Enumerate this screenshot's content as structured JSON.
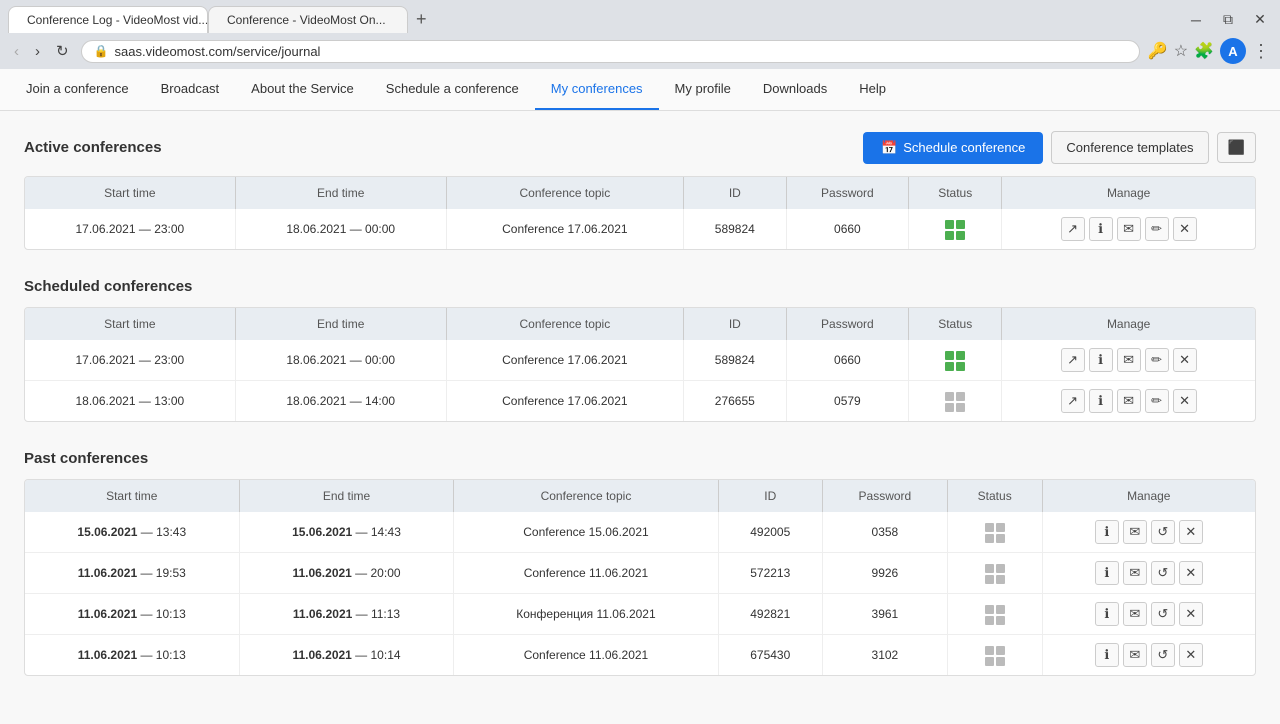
{
  "browser": {
    "tabs": [
      {
        "id": "tab1",
        "label": "Conference Log - VideoMost vid...",
        "favicon_type": "multi",
        "active": true,
        "url": "saas.videomost.com/service/journal"
      },
      {
        "id": "tab2",
        "label": "Conference - VideoMost On...",
        "favicon_type": "red",
        "active": false,
        "url": ""
      }
    ],
    "url": "saas.videomost.com/service/journal",
    "nav_buttons": {
      "back": "‹",
      "forward": "›",
      "reload": "↻"
    }
  },
  "nav": {
    "items": [
      {
        "label": "Join a conference",
        "active": false
      },
      {
        "label": "Broadcast",
        "active": false
      },
      {
        "label": "About the Service",
        "active": false
      },
      {
        "label": "Schedule a conference",
        "active": false
      },
      {
        "label": "My conferences",
        "active": true
      },
      {
        "label": "My profile",
        "active": false
      },
      {
        "label": "Downloads",
        "active": false
      },
      {
        "label": "Help",
        "active": false
      }
    ]
  },
  "page": {
    "active_conferences": {
      "title": "Active conferences",
      "schedule_btn": "Schedule conference",
      "templates_btn": "Conference templates",
      "table": {
        "columns": [
          "Start time",
          "End time",
          "Conference topic",
          "ID",
          "Password",
          "Status",
          "Manage"
        ],
        "rows": [
          {
            "start": "17.06.2021 — 23:00",
            "end": "18.06.2021 — 00:00",
            "topic": "Conference 17.06.2021",
            "id": "589824",
            "password": "0660",
            "status": "active"
          }
        ]
      }
    },
    "scheduled_conferences": {
      "title": "Scheduled conferences",
      "table": {
        "columns": [
          "Start time",
          "End time",
          "Conference topic",
          "ID",
          "Password",
          "Status",
          "Manage"
        ],
        "rows": [
          {
            "start": "17.06.2021 — 23:00",
            "end": "18.06.2021 — 00:00",
            "topic": "Conference 17.06.2021",
            "id": "589824",
            "password": "0660",
            "status": "active"
          },
          {
            "start": "18.06.2021 — 13:00",
            "end": "18.06.2021 — 14:00",
            "topic": "Conference 17.06.2021",
            "id": "276655",
            "password": "0579",
            "status": "inactive"
          }
        ]
      }
    },
    "past_conferences": {
      "title": "Past conferences",
      "table": {
        "columns": [
          "Start time",
          "End time",
          "Conference topic",
          "ID",
          "Password",
          "Status",
          "Manage"
        ],
        "rows": [
          {
            "start_bold": "15.06.2021",
            "start_rest": " — 13:43",
            "end_bold": "15.06.2021",
            "end_rest": " — 14:43",
            "topic": "Conference 15.06.2021",
            "id": "492005",
            "password": "0358"
          },
          {
            "start_bold": "11.06.2021",
            "start_rest": " — 19:53",
            "end_bold": "11.06.2021",
            "end_rest": " — 20:00",
            "topic": "Conference 11.06.2021",
            "id": "572213",
            "password": "9926"
          },
          {
            "start_bold": "11.06.2021",
            "start_rest": " — 10:13",
            "end_bold": "11.06.2021",
            "end_rest": " — 11:13",
            "topic": "Конференция 11.06.2021",
            "id": "492821",
            "password": "3961"
          },
          {
            "start_bold": "11.06.2021",
            "start_rest": " — 10:13",
            "end_bold": "11.06.2021",
            "end_rest": " — 10:14",
            "topic": "Conference 11.06.2021",
            "id": "675430",
            "password": "3102"
          }
        ]
      }
    }
  }
}
